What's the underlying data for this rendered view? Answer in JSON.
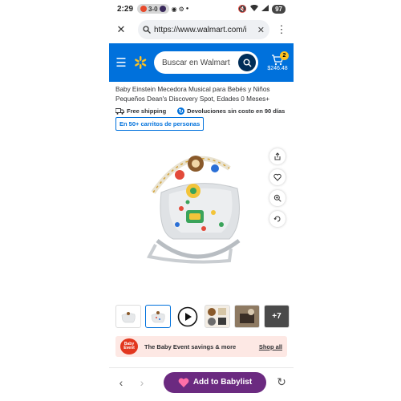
{
  "status_bar": {
    "time": "2:29",
    "score": "3-0",
    "battery": "97"
  },
  "browser": {
    "url": "https://www.walmart.com/i"
  },
  "header": {
    "search_placeholder": "Buscar en Walmart",
    "cart_count": "2",
    "cart_total": "$246.48",
    "colors": {
      "brand": "#0071dc",
      "spark": "#ffc220"
    }
  },
  "product": {
    "title": "Baby Einstein Mecedora Musical para Bebés y Niños Pequeños Dean's Discovery Spot, Edades 0 Meses+",
    "free_shipping": "Free shipping",
    "returns": "Devoluciones sin costo en 90 días",
    "cart_badge": "En 50+ carritos de personas"
  },
  "thumbnails": {
    "more_label": "+7"
  },
  "promo": {
    "logo_text": "Baby Event",
    "message": "The Baby Event savings & more",
    "link": "Shop all"
  },
  "bottom_bar": {
    "babylist_label": "Add to Babylist",
    "babylist_color": "#6b2a80"
  }
}
